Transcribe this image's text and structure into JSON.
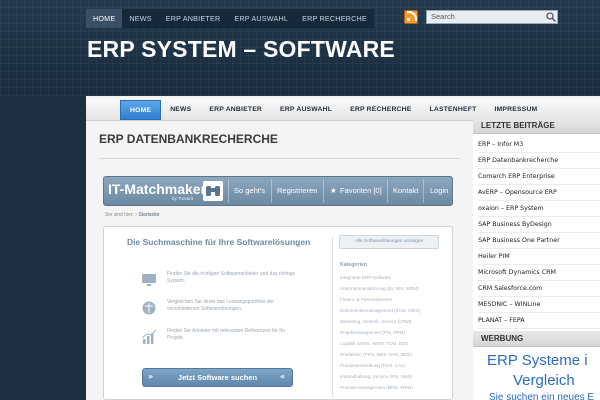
{
  "topnav": [
    "HOME",
    "NEWS",
    "ERP ANBIETER",
    "ERP AUSWAHL",
    "ERP RECHERCHE"
  ],
  "search": {
    "placeholder": "Search"
  },
  "site_title": "ERP SYSTEM – SOFTWARE",
  "mainnav": [
    "HOME",
    "NEWS",
    "ERP ANBIETER",
    "ERP AUSWAHL",
    "ERP RECHERCHE",
    "LASTENHEFT",
    "IMPRESSUM"
  ],
  "page_title": "ERP DATENBANKRECHERCHE",
  "matchmaker": {
    "logo": "IT-Matchmaker",
    "logo_sub": "by Trovarit",
    "nav": [
      "So geht's",
      "Registrieren",
      "Favoriten [0]",
      "Kontakt",
      "Login"
    ],
    "breadcrumb_prefix": "Sie sind hier:",
    "breadcrumb_current": "Startseite",
    "heading": "Die Suchmaschine für Ihre Softwarelösungen",
    "all_button": "Alle Softwarelösungen anzeigen",
    "features": [
      {
        "icon": "monitor-icon",
        "text": "Finden Sie die richtigen Softwareanbieter und das richtige System."
      },
      {
        "icon": "compare-icon",
        "text": "Vergleichen Sie direkt das Leistungsportfolio der verschiedenen Softwarelösungen."
      },
      {
        "icon": "chart-icon",
        "text": "Finden Sie Anbieter mit relevanten Referenzen für Ihr Projekt."
      }
    ],
    "categories_title": "Kategorien",
    "categories": [
      "Integrierte ERP-Software",
      "Unternehmensführung (BI, MIS, MDM)",
      "Finanz- & Personalwesen",
      "Dokumentenmanagement (ECM, DMS)",
      "Marketing, Vertrieb, Service (CRM)",
      "Projektmanagement (PM, PPM)",
      "Logistik (WMS, WWS, TOM, EDI)",
      "Produktion (PPS, MES, DAS, BDE)",
      "Produktentwicklung (PLM, CAx)",
      "Instandhaltung, Service (IPS, SMS)",
      "Prozess-Management (BPM, WFM)"
    ],
    "cta": "Jetzt Software suchen"
  },
  "sidebar": {
    "recent_title": "LETZTE BEITRÄGE",
    "recent": [
      "ERP – Infor M3",
      "ERP Datenbankrecherche",
      "Comarch ERP Enterprise",
      "AvERP – Opensource ERP",
      "oxaion – ERP System",
      "SAP Business ByDesign",
      "SAP Business One Partner",
      "Heiler PIM",
      "Microsoft Dynamics CRM",
      "CRM Salesforce.com",
      "MESONIC – WINLine",
      "PLANAT – FEPA"
    ],
    "ad_title": "WERBUNG",
    "ad_line1": "ERP Systeme i",
    "ad_line2": "Vergleich",
    "ad_line3": "Sie suchen ein neues E"
  },
  "colors": {
    "accent": "#2f7fcf",
    "header_bg": "#1f2f3f",
    "ad_link": "#2a6cc0"
  }
}
